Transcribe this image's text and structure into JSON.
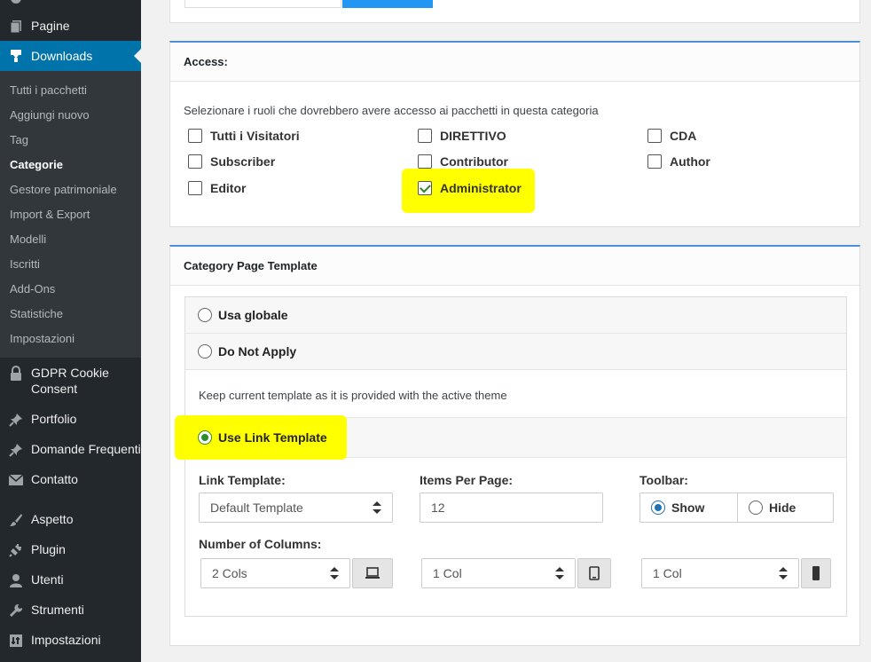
{
  "sidebar": {
    "menu": [
      {
        "label": "Pagine",
        "icon": "pages-icon"
      },
      {
        "label": "Downloads",
        "icon": "download-icon"
      },
      {
        "label": "GDPR Cookie Consent",
        "icon": "lock-icon"
      },
      {
        "label": "Portfolio",
        "icon": "pin-icon"
      },
      {
        "label": "Domande Frequenti",
        "icon": "pin-icon"
      },
      {
        "label": "Contatto",
        "icon": "mail-icon"
      },
      {
        "label": "Aspetto",
        "icon": "brush-icon"
      },
      {
        "label": "Plugin",
        "icon": "plugin-icon"
      },
      {
        "label": "Utenti",
        "icon": "user-icon"
      },
      {
        "label": "Strumenti",
        "icon": "wrench-icon"
      },
      {
        "label": "Impostazioni",
        "icon": "settings-icon"
      }
    ],
    "gdpr_line1": "GDPR Cookie",
    "gdpr_line2": "Consent",
    "submenu": [
      "Tutti i pacchetti",
      "Aggiungi nuovo",
      "Tag",
      "Categorie",
      "Gestore patrimoniale",
      "Import & Export",
      "Modelli",
      "Iscritti",
      "Add-Ons",
      "Statistiche",
      "Impostazioni"
    ],
    "current_submenu": "Categorie"
  },
  "access": {
    "title": "Access:",
    "description": "Selezionare i ruoli che dovrebbero avere accesso ai pacchetti in questa categoria",
    "roles": [
      {
        "label": "Tutti i Visitatori",
        "checked": false
      },
      {
        "label": "DIRETTIVO",
        "checked": false
      },
      {
        "label": "CDA",
        "checked": false
      },
      {
        "label": "Subscriber",
        "checked": false
      },
      {
        "label": "Contributor",
        "checked": false
      },
      {
        "label": "Author",
        "checked": false
      },
      {
        "label": "Editor",
        "checked": false
      },
      {
        "label": "Administrator",
        "checked": true
      }
    ]
  },
  "template": {
    "title": "Category Page Template",
    "options": [
      {
        "label": "Usa globale",
        "selected": false
      },
      {
        "label": "Do Not Apply",
        "selected": false
      },
      {
        "label": "Use Link Template",
        "selected": true
      }
    ],
    "do_not_apply_desc": "Keep current template as it is provided with the active theme",
    "link_template_label": "Link Template:",
    "link_template_value": "Default Template",
    "items_per_page_label": "Items Per Page:",
    "items_per_page_value": "12",
    "toolbar_label": "Toolbar:",
    "toolbar_show": "Show",
    "toolbar_hide": "Hide",
    "toolbar_value": "Show",
    "columns_label": "Number of Columns:",
    "columns_desktop": "2 Cols",
    "columns_tablet": "1 Col",
    "columns_mobile": "1 Col"
  },
  "colors": {
    "sidebar_bg": "#23282d",
    "active_menu": "#0073aa",
    "highlight": "#ffff00",
    "accent_blue": "#2196f3"
  }
}
